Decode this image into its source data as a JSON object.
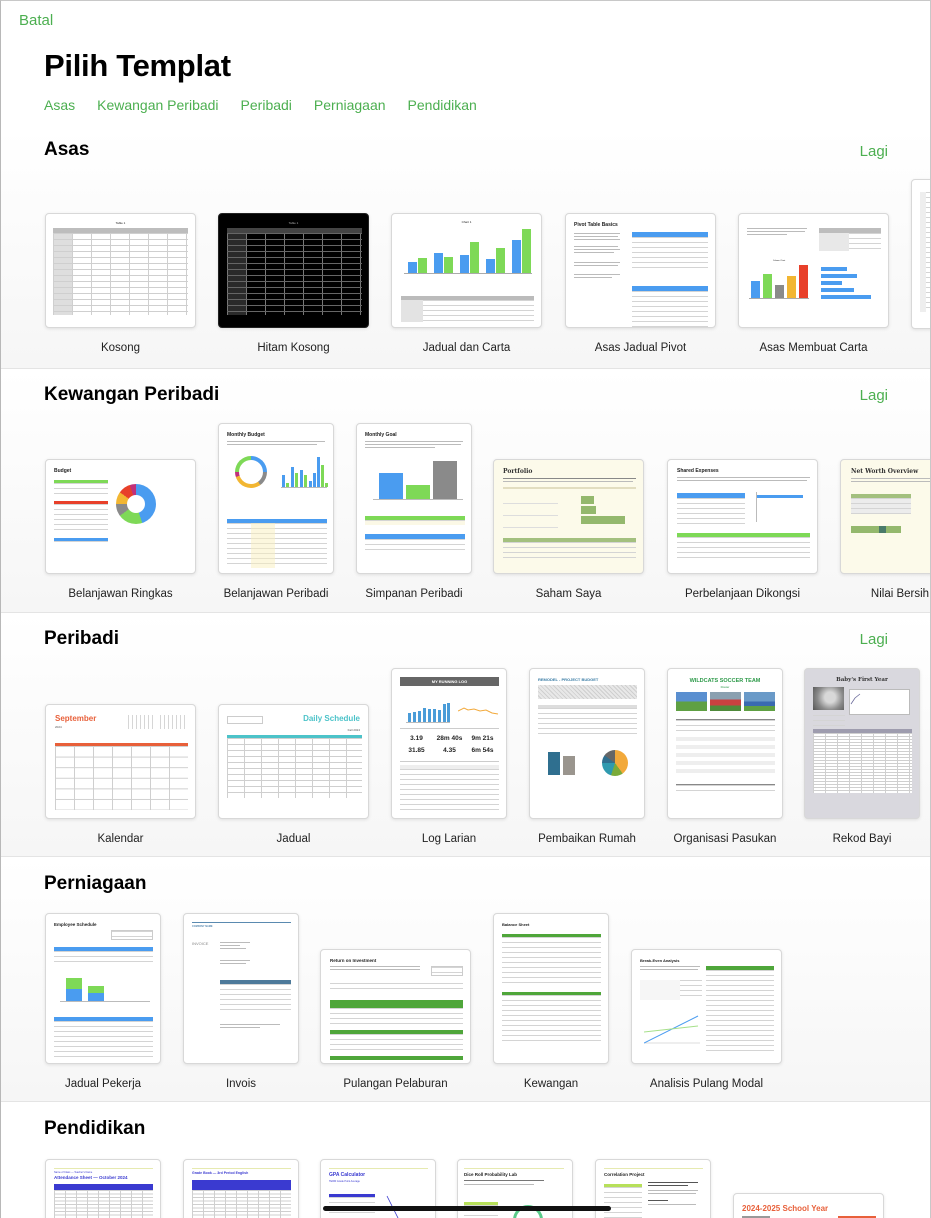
{
  "header": {
    "cancel_label": "Batal",
    "title": "Pilih Templat",
    "categories": [
      "Asas",
      "Kewangan Peribadi",
      "Peribadi",
      "Perniagaan",
      "Pendidikan"
    ]
  },
  "colors": {
    "accent": "#4caf50",
    "chart_blue": "#4a9cf0",
    "chart_green": "#7ed957"
  },
  "sections": [
    {
      "title": "Asas",
      "more_label": "Lagi",
      "templates": [
        {
          "label": "Kosong",
          "thumb_title": "Table 1"
        },
        {
          "label": "Hitam Kosong",
          "thumb_title": "Table 1"
        },
        {
          "label": "Jadual dan Carta",
          "thumb_title": "Chart 1"
        },
        {
          "label": "Asas Jadual Pivot",
          "thumb_title": "Pivot Table Basics"
        },
        {
          "label": "Asas Membuat Carta",
          "thumb_title": "Column Chart"
        }
      ]
    },
    {
      "title": "Kewangan Peribadi",
      "more_label": "Lagi",
      "templates": [
        {
          "label": "Belanjawan Ringkas",
          "thumb_title": "Budget"
        },
        {
          "label": "Belanjawan Peribadi",
          "thumb_title": "Monthly Budget"
        },
        {
          "label": "Simpanan Peribadi",
          "thumb_title": "Monthly Goal"
        },
        {
          "label": "Saham Saya",
          "thumb_title": "Portfolio"
        },
        {
          "label": "Perbelanjaan Dikongsi",
          "thumb_title": "Shared Expenses"
        },
        {
          "label": "Nilai Bersih",
          "thumb_title": "Net Worth Overview"
        }
      ]
    },
    {
      "title": "Peribadi",
      "more_label": "Lagi",
      "templates": [
        {
          "label": "Kalendar",
          "thumb_title": "September",
          "thumb_sub": "2024"
        },
        {
          "label": "Jadual",
          "thumb_title": "Daily Schedule",
          "thumb_sub": "Fall 2024"
        },
        {
          "label": "Log Larian",
          "thumb_title": "MY RUNNING LOG",
          "stats": [
            "3.19",
            "28m 40s",
            "9m 21s",
            "31.85",
            "4.35",
            "6m 54s"
          ]
        },
        {
          "label": "Pembaikan Rumah",
          "thumb_title": "REMODEL - PROJECT BUDGET"
        },
        {
          "label": "Organisasi Pasukan",
          "thumb_title": "WILDCATS SOCCER TEAM",
          "thumb_sub": "Roster"
        },
        {
          "label": "Rekod Bayi",
          "thumb_title": "Baby's First Year"
        }
      ]
    },
    {
      "title": "Perniagaan",
      "templates": [
        {
          "label": "Jadual Pekerja",
          "thumb_title": "Employee Schedule"
        },
        {
          "label": "Invois",
          "thumb_title": "INVOICE",
          "thumb_sub": "COMPANY NAME"
        },
        {
          "label": "Pulangan Pelaburan",
          "thumb_title": "Return on Investment"
        },
        {
          "label": "Kewangan",
          "thumb_title": "Balance Sheet"
        },
        {
          "label": "Analisis Pulang Modal",
          "thumb_title": "Break-Even Analysis"
        }
      ]
    },
    {
      "title": "Pendidikan",
      "templates": [
        {
          "label": "",
          "thumb_title": "Attendance Sheet — October 2024",
          "thumb_sub": "Name of Class — Teacher's Name"
        },
        {
          "label": "",
          "thumb_title": "Grade Book — 3rd Period English"
        },
        {
          "label": "",
          "thumb_title": "GPA Calculator",
          "thumb_sub": "TERM Grade Point Average"
        },
        {
          "label": "",
          "thumb_title": "Dice Roll Probability Lab"
        },
        {
          "label": "",
          "thumb_title": "Correlation Project"
        },
        {
          "label": "",
          "thumb_title": "2024-2025 School Year"
        }
      ]
    }
  ]
}
